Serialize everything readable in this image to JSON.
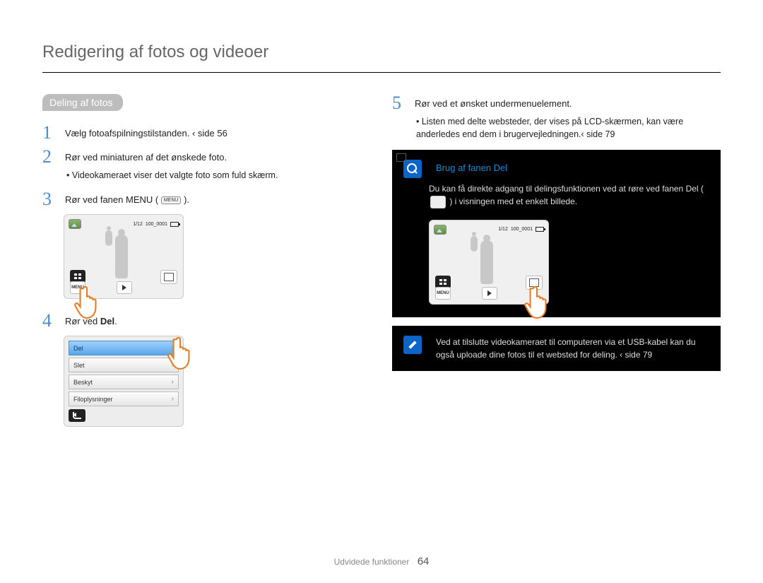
{
  "page_title": "Redigering af fotos og videoer",
  "section_pill": "Deling af fotos",
  "footer": {
    "section": "Udvidede funktioner",
    "page": "64"
  },
  "steps": {
    "s1": {
      "num": "1",
      "text": "Vælg fotoafspilningstilstanden.  ‹ side 56"
    },
    "s2": {
      "num": "2",
      "text": "Rør ved miniaturen af det ønskede foto.",
      "bullet": "Videokameraet viser det valgte foto som fuld skærm."
    },
    "s3": {
      "num": "3",
      "text_pre": "Rør ved fanen MENU (",
      "chip": "MENU",
      "text_post": ")."
    },
    "s4": {
      "num": "4",
      "text_pre": "Rør ved ",
      "bold": "Del",
      "text_post": "."
    },
    "s5": {
      "num": "5",
      "text": "Rør ved et ønsket undermenuelement.",
      "bullet": "Listen med delte websteder, der vises på LCD-skærmen, kan være anderledes end dem i brugervejledningen.‹ side 79"
    }
  },
  "lcd": {
    "counter": "1/12",
    "file": "100_0001",
    "menu_label": "MENU"
  },
  "menu_items": {
    "del": "Del",
    "slet": "Slet",
    "beskyt": "Beskyt",
    "filop": "Filoplysninger"
  },
  "callout1": {
    "title": "Brug af fanen Del",
    "body_pre": "Du kan få direkte adgang til delingsfunktionen ved at røre ved fanen Del (",
    "body_post": ") i visningen med et enkelt billede."
  },
  "callout2": {
    "body": "Ved at tilslutte videokameraet til computeren via et USB-kabel kan du også uploade dine fotos til et websted for deling. ‹ side 79"
  }
}
